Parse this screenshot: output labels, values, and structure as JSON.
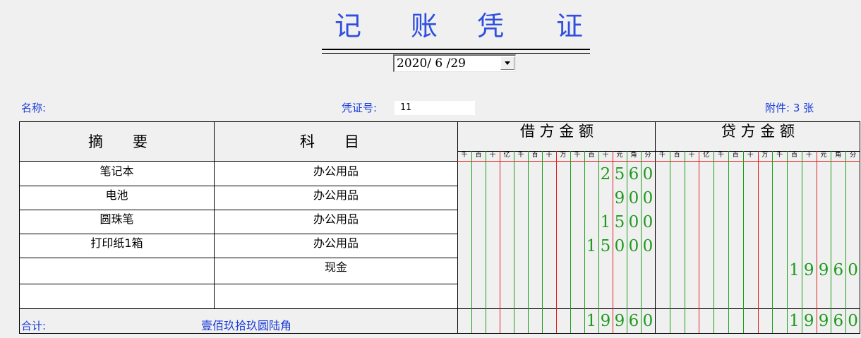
{
  "voucher": {
    "title_chars": [
      "记",
      "账",
      "凭",
      "证"
    ],
    "date_value": "2020/ 6 /29",
    "name_label": "名称:",
    "voucher_no_label": "凭证号:",
    "voucher_no_value": "11",
    "attachment_label": "附件: 3 张"
  },
  "table": {
    "headers": {
      "summary": "摘　　要",
      "account": "科　　目",
      "debit": "借 方 金 额",
      "credit": "贷 方 金 额"
    },
    "unit_labels": [
      "千",
      "百",
      "十",
      "亿",
      "千",
      "百",
      "十",
      "万",
      "千",
      "百",
      "十",
      "元",
      "角",
      "分"
    ],
    "rows": [
      {
        "summary": "笔记本",
        "account": "办公用品",
        "debit": "2560",
        "credit": ""
      },
      {
        "summary": "电池",
        "account": "办公用品",
        "debit": "900",
        "credit": ""
      },
      {
        "summary": "圆珠笔",
        "account": "办公用品",
        "debit": "1500",
        "credit": ""
      },
      {
        "summary": "打印纸1箱",
        "account": "办公用品",
        "debit": "15000",
        "credit": ""
      },
      {
        "summary": "",
        "account": "现金",
        "debit": "",
        "credit": "19960"
      },
      {
        "summary": "",
        "account": "",
        "debit": "",
        "credit": ""
      }
    ],
    "total": {
      "label": "合计:",
      "amount_words": "壹佰玖拾玖圆陆角",
      "debit": "19960",
      "credit": "19960"
    }
  },
  "colors": {
    "accent_blue": "#2f4fe0",
    "label_blue": "#1a3cd8",
    "digit_green": "#1e9a1e",
    "grid_green": "#19a019",
    "grid_red": "#e02020"
  }
}
